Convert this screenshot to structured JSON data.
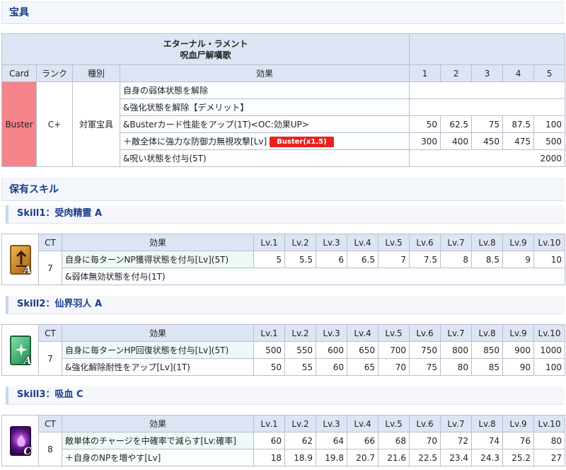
{
  "np_section": {
    "title": "宝具",
    "name": "エターナル・ラメント",
    "ruby": "呪血尸解嘆歌",
    "headers": {
      "card": "Card",
      "rank": "ランク",
      "type": "種別",
      "effect": "効果",
      "levels": [
        "1",
        "2",
        "3",
        "4",
        "5"
      ]
    },
    "card": "Buster",
    "rank": "C+",
    "type": "対軍宝具",
    "colors": {
      "buster": "#f5838a",
      "badge": "#e8201e"
    },
    "rows": [
      {
        "effect": "自身の弱体状態を解除",
        "values": []
      },
      {
        "effect": "&強化状態を解除【デメリット】",
        "values": []
      },
      {
        "effect": "&Busterカード性能をアップ(1T)<OC:効果UP>",
        "values": [
          "50",
          "62.5",
          "75",
          "87.5",
          "100"
        ]
      },
      {
        "effect": "＋敵全体に強力な防御力無視攻撃[Lv]",
        "badge": "Buster(x1.5)",
        "values": [
          "300",
          "400",
          "450",
          "475",
          "500"
        ]
      },
      {
        "effect": "&呪い状態を付与(5T)",
        "single": "2000"
      }
    ]
  },
  "skills_section": {
    "title": "保有スキル"
  },
  "skill_headers": {
    "ct": "CT",
    "effect": "効果",
    "levels": [
      "Lv.1",
      "Lv.2",
      "Lv.3",
      "Lv.4",
      "Lv.5",
      "Lv.6",
      "Lv.7",
      "Lv.8",
      "Lv.9",
      "Lv.10"
    ]
  },
  "skills": [
    {
      "title": "Skill1：受肉精霊 A",
      "icon": "buff-up-icon",
      "rank_letter": "A",
      "ct": "7",
      "rows": [
        {
          "effect": "自身に毎ターンNP獲得状態を付与[Lv](5T)",
          "values": [
            "5",
            "5.5",
            "6",
            "6.5",
            "7",
            "7.5",
            "8",
            "8.5",
            "9",
            "10"
          ]
        },
        {
          "effect": "&弱体無効状態を付与(1T)",
          "values": []
        }
      ]
    },
    {
      "title": "Skill2：仙界羽人 A",
      "icon": "heal-sparkle-icon",
      "rank_letter": "A",
      "ct": "7",
      "rows": [
        {
          "effect": "自身に毎ターンHP回復状態を付与[Lv](5T)",
          "values": [
            "500",
            "550",
            "600",
            "650",
            "700",
            "750",
            "800",
            "850",
            "900",
            "1000"
          ]
        },
        {
          "effect": "&強化解除耐性をアップ[Lv](1T)",
          "values": [
            "50",
            "55",
            "60",
            "65",
            "70",
            "75",
            "80",
            "85",
            "90",
            "100"
          ]
        }
      ]
    },
    {
      "title": "Skill3：吸血 C",
      "icon": "drain-icon",
      "rank_letter": "C",
      "ct": "8",
      "rows": [
        {
          "effect": "敵単体のチャージを中確率で減らす[Lv:確率]",
          "values": [
            "60",
            "62",
            "64",
            "66",
            "68",
            "70",
            "72",
            "74",
            "76",
            "80"
          ]
        },
        {
          "effect": "＋自身のNPを増やす[Lv]",
          "values": [
            "18",
            "18.9",
            "19.8",
            "20.7",
            "21.6",
            "22.5",
            "23.4",
            "24.3",
            "25.2",
            "27"
          ]
        }
      ]
    }
  ]
}
